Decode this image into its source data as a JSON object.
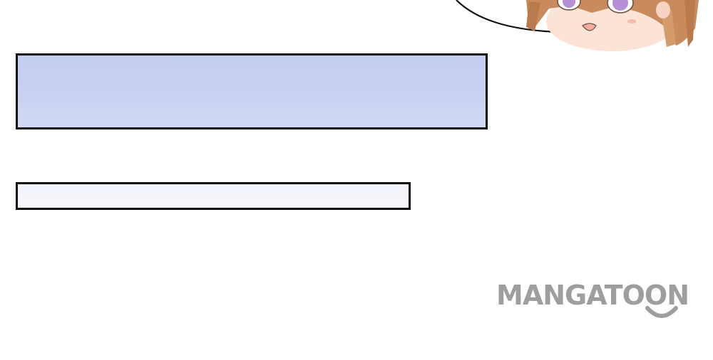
{
  "panels": [
    {
      "name": "speech-panel-large",
      "fill": "#c8d1f2"
    },
    {
      "name": "speech-panel-small",
      "fill": "#f4f5fb"
    }
  ],
  "watermark": {
    "text": "MANGATOON",
    "color": "#9e9e9e"
  },
  "character": {
    "icon": "chibi-girl-face",
    "hair_color": "#c98b5d",
    "eye_color": "#b68fd6",
    "skin_color": "#fbe3d6"
  },
  "colors": {
    "border": "#0b0b0b",
    "background": "#ffffff"
  }
}
